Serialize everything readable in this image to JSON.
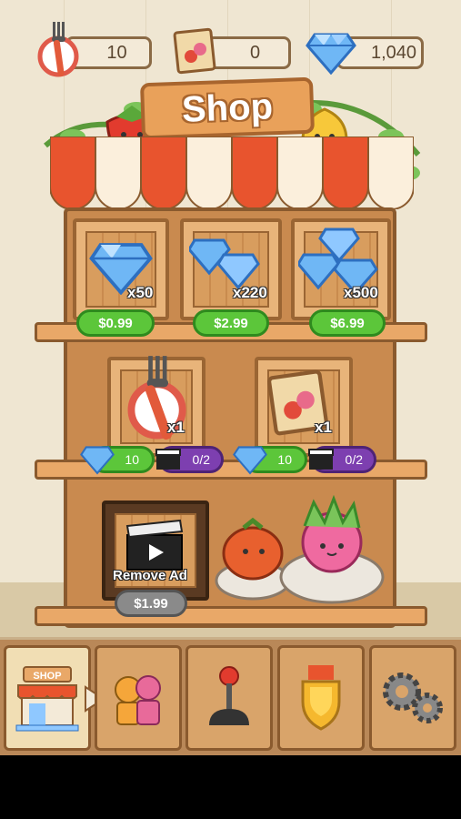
{
  "resources": {
    "forks": "10",
    "seed_packs": "0",
    "gems": "1,040"
  },
  "sign": {
    "title": "Shop"
  },
  "gem_packs": [
    {
      "qty": "x50",
      "price": "$0.99"
    },
    {
      "qty": "x220",
      "price": "$2.99"
    },
    {
      "qty": "x500",
      "price": "$6.99"
    }
  ],
  "items": [
    {
      "name": "fork",
      "qty": "x1",
      "gem_cost": "10",
      "ad_progress": "0/2"
    },
    {
      "name": "seed-pack",
      "qty": "x1",
      "gem_cost": "10",
      "ad_progress": "0/2"
    }
  ],
  "remove_ad": {
    "label": "Remove Ad",
    "price": "$1.99"
  },
  "shop_tab_sign": "SHOP",
  "nav_tabs": [
    "shop-icon",
    "characters-icon",
    "joystick-icon",
    "badge-icon",
    "settings-gears-icon"
  ],
  "colors": {
    "price_green": "#5cc63a",
    "ad_purple": "#7d3fb0",
    "wood": "#c98a4f"
  }
}
